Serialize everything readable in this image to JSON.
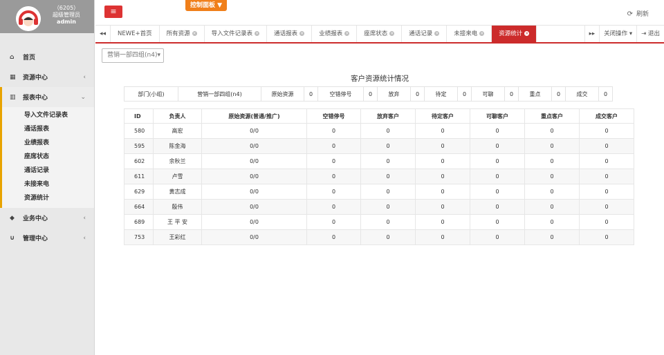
{
  "profile": {
    "code": "（6205）",
    "role": "超级管理员",
    "name": "admin"
  },
  "sidebar": {
    "items": [
      {
        "label": "首页",
        "icon": "home-icon",
        "glyph": "⌂"
      },
      {
        "label": "资源中心",
        "icon": "table-icon",
        "glyph": "▦"
      },
      {
        "label": "报表中心",
        "icon": "bar-chart-icon",
        "glyph": "▥"
      }
    ],
    "sub_items": [
      "导入文件记录表",
      "通话报表",
      "业绩报表",
      "座席状态",
      "通话记录",
      "未接来电",
      "资源统计"
    ],
    "bottom_items": [
      {
        "label": "业务中心",
        "icon": "graduation-cap-icon",
        "glyph": "◆"
      },
      {
        "label": "管理中心",
        "icon": "magnet-icon",
        "glyph": "∪"
      }
    ]
  },
  "header": {
    "control_panel": "控制面板 ▼",
    "refresh": "刷新",
    "refresh_glyph": "⟳",
    "menu_glyph": "≡"
  },
  "tabbar": {
    "prev_glyph": "◂◂",
    "next_glyph": "▸▸",
    "tabs": [
      "NEWE+首页",
      "所有资源",
      "导入文件记录表",
      "通话报表",
      "业绩报表",
      "座席状态",
      "通话记录",
      "未接来电",
      "资源统计"
    ],
    "close_actions": "关闭操作 ▾",
    "logout": "退出",
    "close_glyph": "×",
    "logout_glyph": "⇥"
  },
  "content": {
    "group_select": "营销一部四组(n4)▾",
    "title": "客户资源统计情况",
    "summary": {
      "dept_label": "部门(小组)",
      "dept_value": "营销一部四组(n4)",
      "raw_label": "原始资源",
      "raw_value": "0",
      "empty_label": "空错停号",
      "empty_value": "0",
      "abandon_label": "放弃",
      "abandon_value": "0",
      "pending_label": "待定",
      "pending_value": "0",
      "talkable_label": "可聊",
      "talkable_value": "0",
      "key_label": "重点",
      "key_value": "0",
      "deal_label": "成交",
      "deal_value": "0"
    },
    "table": {
      "headers": [
        "ID",
        "负责人",
        "原始资源(普通/推广)",
        "空错停号",
        "放弃客户",
        "待定客户",
        "可聊客户",
        "重点客户",
        "成交客户"
      ],
      "rows": [
        [
          "580",
          "高宏",
          "0/0",
          "0",
          "0",
          "0",
          "0",
          "0",
          "0"
        ],
        [
          "595",
          "陈金海",
          "0/0",
          "0",
          "0",
          "0",
          "0",
          "0",
          "0"
        ],
        [
          "602",
          "余秋兰",
          "0/0",
          "0",
          "0",
          "0",
          "0",
          "0",
          "0"
        ],
        [
          "611",
          "卢雪",
          "0/0",
          "0",
          "0",
          "0",
          "0",
          "0",
          "0"
        ],
        [
          "629",
          "黄志成",
          "0/0",
          "0",
          "0",
          "0",
          "0",
          "0",
          "0"
        ],
        [
          "664",
          "殷伟",
          "0/0",
          "0",
          "0",
          "0",
          "0",
          "0",
          "0"
        ],
        [
          "689",
          "王 平 安",
          "0/0",
          "0",
          "0",
          "0",
          "0",
          "0",
          "0"
        ],
        [
          "753",
          "王彩红",
          "0/0",
          "0",
          "0",
          "0",
          "0",
          "0",
          "0"
        ]
      ]
    }
  },
  "colors": {
    "accent_red": "#cc2b2b",
    "orange": "#f07f1a",
    "sidebar_marker": "#e8a300"
  }
}
